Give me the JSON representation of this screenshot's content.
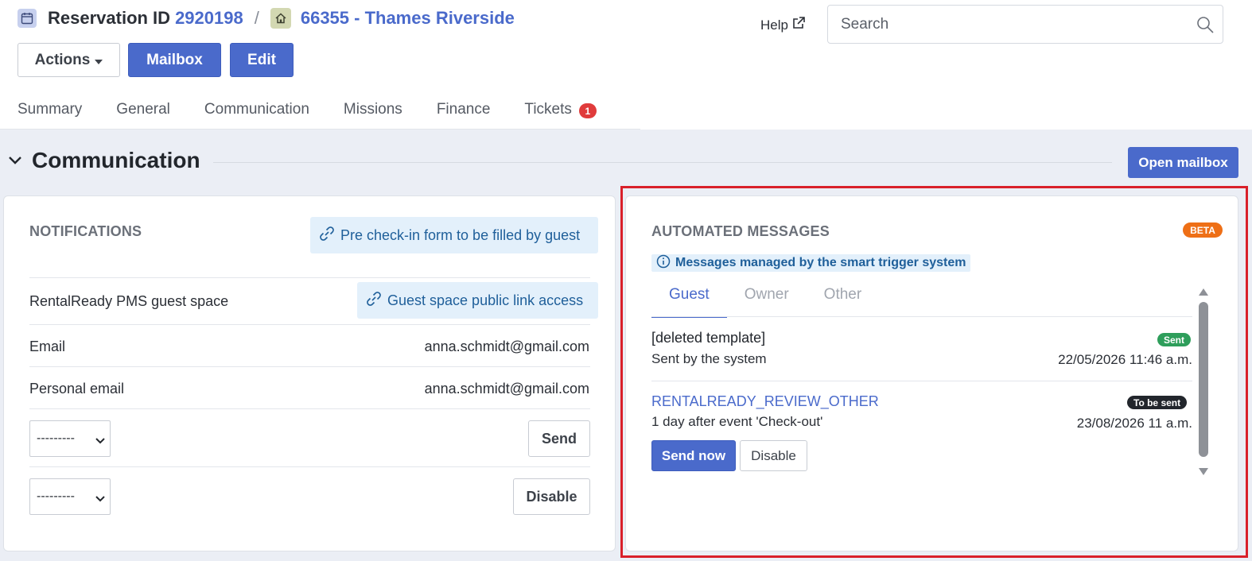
{
  "header": {
    "reservation_label": "Reservation ID",
    "reservation_id": "2920198",
    "separator": "/",
    "property": "66355 - Thames Riverside",
    "help_label": "Help",
    "search_placeholder": "Search"
  },
  "toolbar": {
    "actions_label": "Actions",
    "mailbox_label": "Mailbox",
    "edit_label": "Edit"
  },
  "tabs": [
    {
      "label": "Summary"
    },
    {
      "label": "General"
    },
    {
      "label": "Communication"
    },
    {
      "label": "Missions"
    },
    {
      "label": "Finance"
    },
    {
      "label": "Tickets",
      "badge": "1"
    }
  ],
  "section": {
    "title": "Communication",
    "open_mailbox_label": "Open mailbox"
  },
  "notifications": {
    "title": "NOTIFICATIONS",
    "precheckin_link": "Pre check-in form to be filled by guest",
    "guest_space_label": "RentalReady PMS guest space",
    "guest_space_link": "Guest space public link access",
    "email_label": "Email",
    "email_value": "anna.schmidt@gmail.com",
    "personal_email_label": "Personal email",
    "personal_email_value": "anna.schmidt@gmail.com",
    "select1_value": "---------",
    "select2_value": "---------",
    "send_label": "Send",
    "disable_label": "Disable"
  },
  "automated": {
    "title": "AUTOMATED MESSAGES",
    "beta": "BETA",
    "info": "Messages managed by the smart trigger system",
    "tabs": [
      "Guest",
      "Owner",
      "Other"
    ],
    "active_tab": "Guest",
    "messages": [
      {
        "title": "[deleted template]",
        "subtitle": "Sent by the system",
        "status": "Sent",
        "status_color": "#2e9e5b",
        "date": "22/05/2026 11:46 a.m."
      },
      {
        "title": "RENTALREADY_REVIEW_OTHER",
        "subtitle": "1 day after event 'Check-out'",
        "status": "To be sent",
        "status_color": "#22262c",
        "date": "23/08/2026 11 a.m.",
        "send_now_label": "Send now",
        "disable_label": "Disable"
      }
    ]
  },
  "colors": {
    "accent": "#4a6acb",
    "highlight": "#d9202a",
    "beta": "#ee6f16",
    "badge_red": "#e03b3b"
  }
}
